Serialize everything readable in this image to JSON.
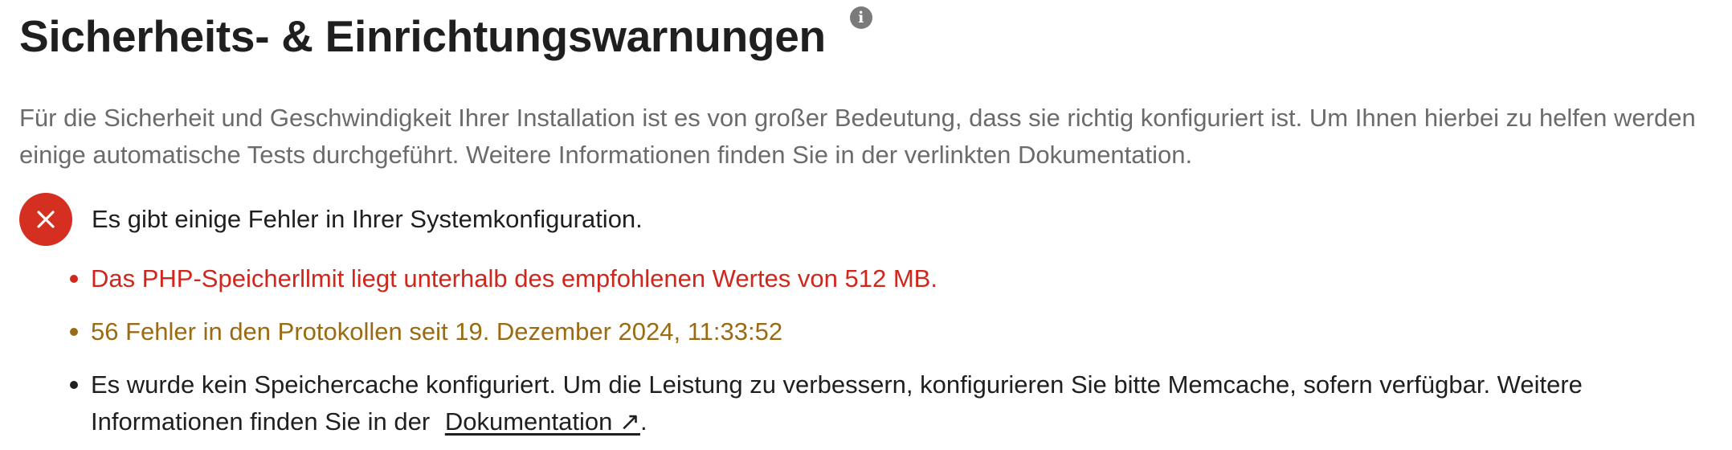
{
  "section": {
    "title": "Sicherheits- & Einrichtungswarnungen",
    "info_icon_glyph": "i",
    "description": "Für die Sicherheit und Geschwindigkeit Ihrer Installation ist es von großer Bedeutung, dass sie richtig konfiguriert ist. Um Ihnen hierbei zu helfen werden einige automatische Tests durchgeführt. Weitere Informationen finden Sie in der verlinkten Dokumentation."
  },
  "status": {
    "icon": "close-icon",
    "text": "Es gibt einige Fehler in Ihrer Systemkonfiguration.",
    "color": "#d52f22"
  },
  "issues": [
    {
      "severity": "error",
      "text": "Das PHP-Speicherllmit liegt unterhalb des empfohlenen Wertes von 512 MB.",
      "color": "#d0261c"
    },
    {
      "severity": "warning",
      "text": "56 Fehler in den Protokollen seit 19. Dezember 2024, 11:33:52",
      "color": "#9a6b12"
    },
    {
      "severity": "info",
      "text": "Es wurde kein Speichercache konfiguriert. Um die Leistung zu verbessern, konfigurieren Sie bitte Memcache, sofern verfügbar. Weitere Informationen finden Sie in der",
      "link_label": "Dokumentation ↗",
      "trailing": ".",
      "color": "#1f1f1f"
    }
  ]
}
